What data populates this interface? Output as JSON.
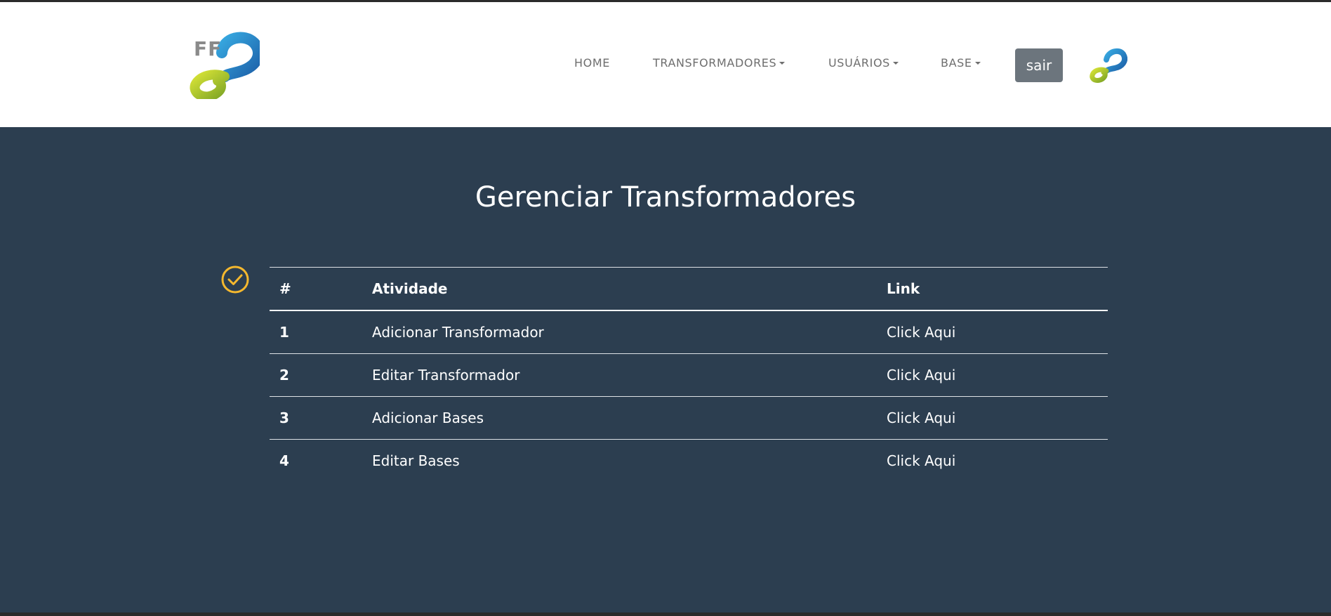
{
  "brand": {
    "logo_text": "FF",
    "logo_icon": "ff2-logo-icon"
  },
  "nav": {
    "items": [
      {
        "label": "HOME",
        "dropdown": false
      },
      {
        "label": "TRANSFORMADORES",
        "dropdown": true
      },
      {
        "label": "USUÁRIOS",
        "dropdown": true
      },
      {
        "label": "BASE",
        "dropdown": true
      }
    ],
    "logout_label": "sair",
    "secondary_logo": "ff2-small-logo-icon"
  },
  "main": {
    "title": "Gerenciar Transformadores",
    "status_icon": "check-circle-icon",
    "table": {
      "headers": [
        "#",
        "Atividade",
        "Link"
      ],
      "rows": [
        {
          "num": "1",
          "activity": "Adicionar Transformador",
          "link": "Click Aqui"
        },
        {
          "num": "2",
          "activity": "Editar Transformador",
          "link": "Click Aqui"
        },
        {
          "num": "3",
          "activity": "Adicionar Bases",
          "link": "Click Aqui"
        },
        {
          "num": "4",
          "activity": "Editar Bases",
          "link": "Click Aqui"
        }
      ]
    }
  },
  "colors": {
    "navbar_bg": "#ffffff",
    "page_bg": "#2c3e50",
    "nav_text": "#6e6e6e",
    "button_bg": "#6c757d",
    "check_icon": "#f5b82e",
    "logo_blue": "#1e7ac4",
    "logo_green": "#a9c82c"
  }
}
